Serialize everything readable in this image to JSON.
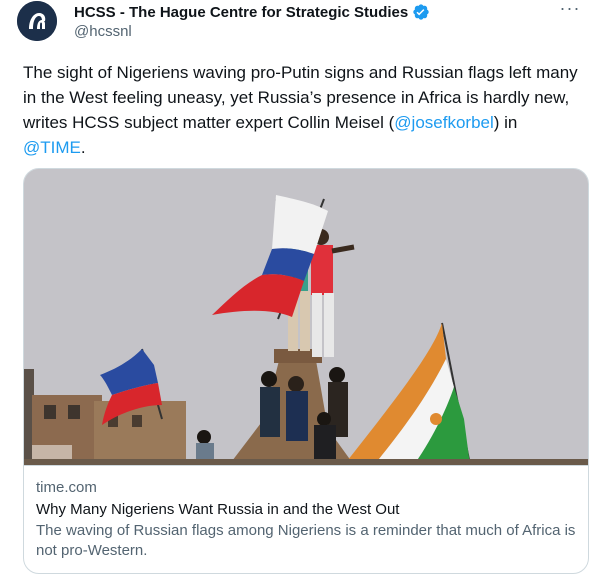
{
  "author": {
    "display_name": "HCSS - The Hague Centre for Strategic Studies",
    "handle": "@hcssnl",
    "verified": true,
    "avatar_icon": "hcss-logo-icon",
    "avatar_color": "#1c2f4a"
  },
  "more_icon": "more-options-icon",
  "tweet": {
    "text_part1": "The sight of Nigeriens waving pro-Putin signs and Russian flags left many in the West feeling uneasy, yet Russia’s presence in Africa is hardly new, writes HCSS subject matter expert Collin Meisel (",
    "mention1": "@josefkorbel",
    "text_part2": ") in ",
    "mention2": "@TIME",
    "text_part3": "."
  },
  "link_card": {
    "domain": "time.com",
    "title": "Why Many Nigeriens Want Russia in and the West Out",
    "description": "The waving of Russian flags among Nigeriens is a reminder that much of Africa is not pro-Western.",
    "image_icon": "news-photo-image"
  },
  "colors": {
    "link": "#1d9bf0",
    "verified": "#1d9bf0",
    "secondary_text": "#536471",
    "border": "#cfd9de"
  }
}
